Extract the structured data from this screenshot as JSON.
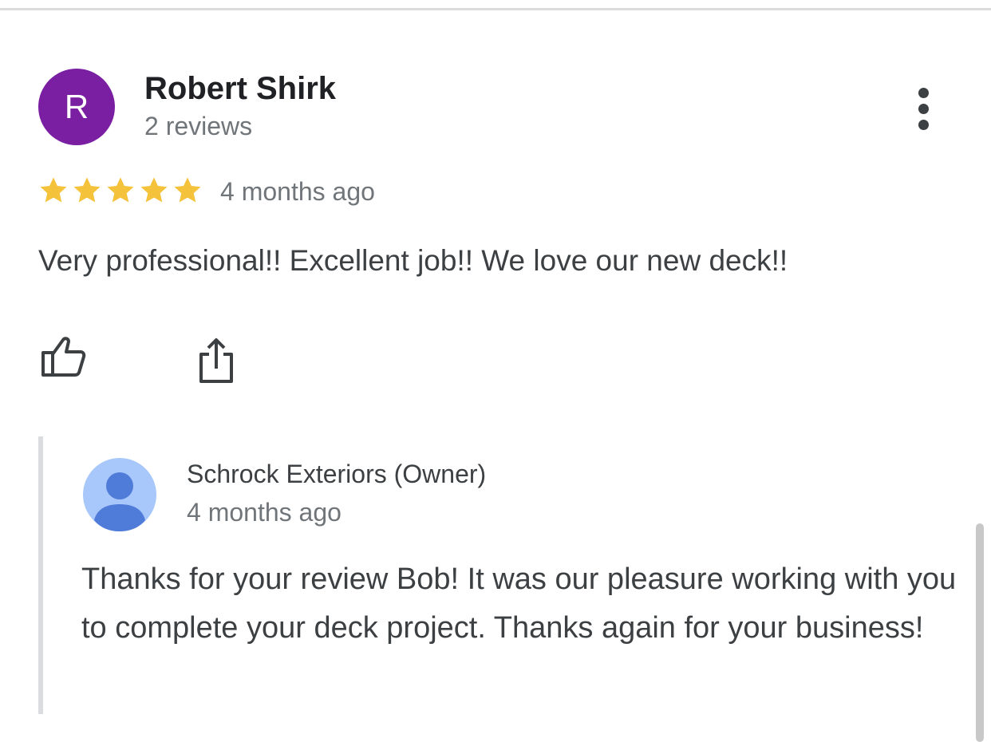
{
  "review": {
    "author_initial": "R",
    "author_name": "Robert Shirk",
    "author_review_count": "2 reviews",
    "rating": 5,
    "rating_max": 5,
    "date": "4 months ago",
    "text": "Very professional!! Excellent job!! We love our new deck!!"
  },
  "owner_reply": {
    "author_name": "Schrock Exteriors (Owner)",
    "date": "4 months ago",
    "text": "Thanks for your review Bob! It was our pleasure working with you to complete your deck project. Thanks again for your business!"
  },
  "icons": {
    "more": "more-vert-icon",
    "like": "thumb-up-icon",
    "share": "share-icon",
    "owner_avatar": "person-icon",
    "star": "star-icon"
  },
  "colors": {
    "avatar_bg": "#7b1fa2",
    "star": "#f4c23b",
    "owner_avatar_bg": "#a8c7fa",
    "owner_avatar_fg": "#4f7bd9",
    "secondary_text": "#70757a"
  }
}
